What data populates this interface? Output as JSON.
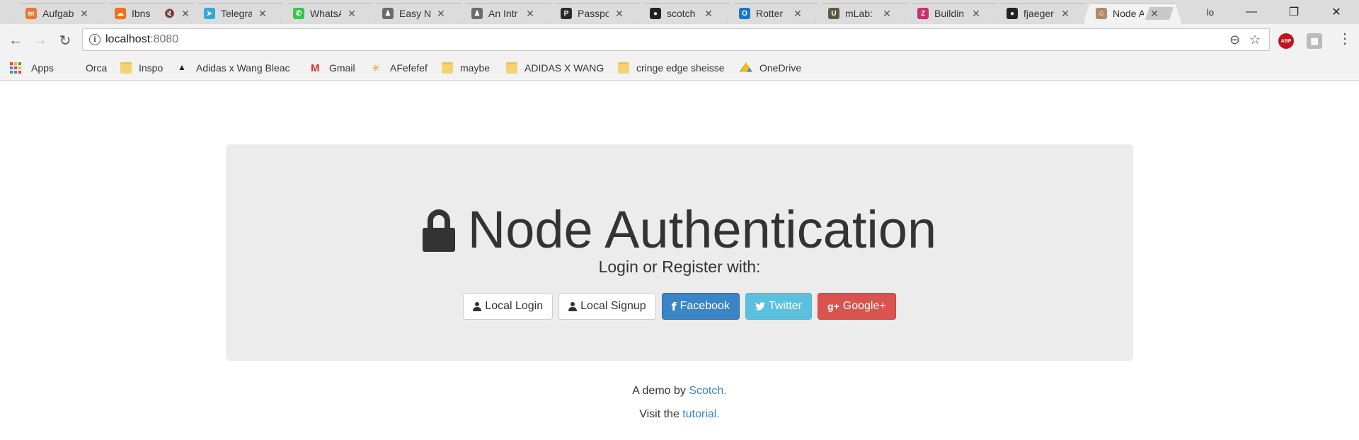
{
  "tabs": [
    {
      "title": "Aufgab",
      "favicon_color": "#e8773a",
      "favicon_char": "m"
    },
    {
      "title": "Ibns",
      "favicon_color": "#f26f21",
      "favicon_char": "☁",
      "muted": true
    },
    {
      "title": "Telegra",
      "favicon_color": "#37a6dc",
      "favicon_char": "➤"
    },
    {
      "title": "WhatsA",
      "favicon_color": "#3cc14f",
      "favicon_char": "✆"
    },
    {
      "title": "Easy N",
      "favicon_color": "#6b6b6b",
      "favicon_char": "♟"
    },
    {
      "title": "An Intr",
      "favicon_color": "#6b6b6b",
      "favicon_char": "♟"
    },
    {
      "title": "Passpo",
      "favicon_color": "#2b2b2b",
      "favicon_char": "P"
    },
    {
      "title": "scotch",
      "favicon_color": "#222222",
      "favicon_char": "●"
    },
    {
      "title": "Rotter",
      "favicon_color": "#1e74c8",
      "favicon_char": "O"
    },
    {
      "title": "mLab: ",
      "favicon_color": "#5a5a40",
      "favicon_char": "U"
    },
    {
      "title": "Buildin",
      "favicon_color": "#c3346d",
      "favicon_char": "Z"
    },
    {
      "title": "fjaeger",
      "favicon_color": "#222222",
      "favicon_char": "●"
    },
    {
      "title": "Node A",
      "favicon_color": "#b08a6a",
      "favicon_char": "☺",
      "active": true
    }
  ],
  "window": {
    "profile": "lo",
    "minimize": "—",
    "restore": "❐",
    "close": "✕"
  },
  "nav": {
    "back": "←",
    "forward": "→",
    "reload": "↻"
  },
  "omnibox": {
    "host": "localhost",
    "port": ":8080",
    "info": "i",
    "zoom_icon": "⊖",
    "star_icon": "☆"
  },
  "extensions": [
    {
      "label": "ABP",
      "color": "#c3131b"
    },
    {
      "label": "▦",
      "color": "#bbbbbb"
    }
  ],
  "menu_dots": "⋮",
  "bookmarks": [
    {
      "label": "Apps",
      "icon": "apps-icon"
    },
    {
      "label": "Orca",
      "icon": "none"
    },
    {
      "label": "Inspo",
      "icon": "folder-icon"
    },
    {
      "label": "Adidas x Wang Bleac",
      "icon": "adidas-icon"
    },
    {
      "label": "Gmail",
      "icon": "gmail-icon"
    },
    {
      "label": "AFefefef",
      "icon": "spark-icon"
    },
    {
      "label": "maybe",
      "icon": "folder-icon"
    },
    {
      "label": "ADIDAS X WANG",
      "icon": "folder-icon"
    },
    {
      "label": "cringe edge sheisse",
      "icon": "folder-icon"
    },
    {
      "label": "OneDrive",
      "icon": "drive-icon"
    }
  ],
  "page": {
    "title": "Node Authentication",
    "subtitle": "Login or Register with:",
    "buttons": [
      {
        "label": "Local Login",
        "style": "default",
        "icon": "user-icon"
      },
      {
        "label": "Local Signup",
        "style": "default",
        "icon": "user-icon"
      },
      {
        "label": "Facebook",
        "style": "primary",
        "icon": "facebook-icon",
        "glyph": "f"
      },
      {
        "label": "Twitter",
        "style": "info",
        "icon": "twitter-icon",
        "glyph": "🐦"
      },
      {
        "label": "Google+",
        "style": "danger",
        "icon": "google-plus-icon",
        "glyph": "g+"
      }
    ],
    "footer": {
      "demo_prefix": "A demo by",
      "demo_link": "Scotch.",
      "visit_prefix": "Visit the",
      "visit_link": "tutorial."
    }
  },
  "colors": {
    "link": "#3a85c6",
    "primary": "#3a85c6",
    "info": "#5bc0de",
    "danger": "#d9534f",
    "jumbotron": "#ececec"
  }
}
